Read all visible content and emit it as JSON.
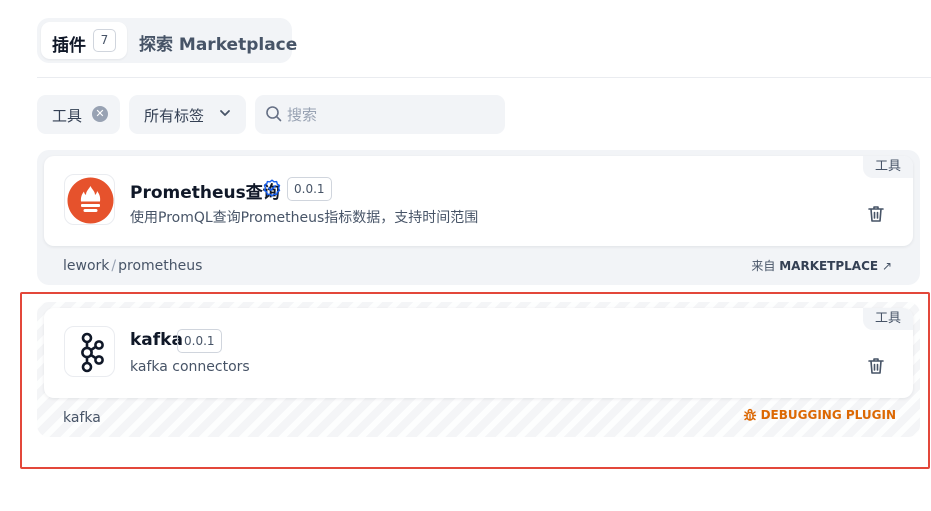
{
  "tabs": {
    "plugins": {
      "label": "插件",
      "count": "7"
    },
    "explore": {
      "label": "探索 Marketplace"
    }
  },
  "filters": {
    "tool_chip": "工具",
    "tags_dropdown": "所有标签",
    "search_placeholder": "搜索"
  },
  "plugins": [
    {
      "name": "Prometheus查询",
      "verified": true,
      "version": "0.0.1",
      "description": "使用PromQL查询Prometheus指标数据，支持时间范围",
      "tag": "工具",
      "org": "lework",
      "repo": "prometheus",
      "source_prefix": "来自",
      "source_name": "MARKETPLACE",
      "source_arrow": "↗"
    },
    {
      "name": "kafka",
      "version": "0.0.1",
      "description": "kafka connectors",
      "tag": "工具",
      "org": "kafka",
      "status": "DEBUGGING PLUGIN"
    }
  ],
  "colors": {
    "accent_highlight": "#e3473a",
    "debug_orange": "#dc6803",
    "verified_blue": "#155eef",
    "prometheus_orange": "#e6522c"
  },
  "icons": [
    "clear-icon",
    "chevron-down-icon",
    "search-icon",
    "prometheus-logo",
    "verified-icon",
    "trash-icon",
    "kafka-logo",
    "bug-icon",
    "arrow-up-right-icon"
  ]
}
